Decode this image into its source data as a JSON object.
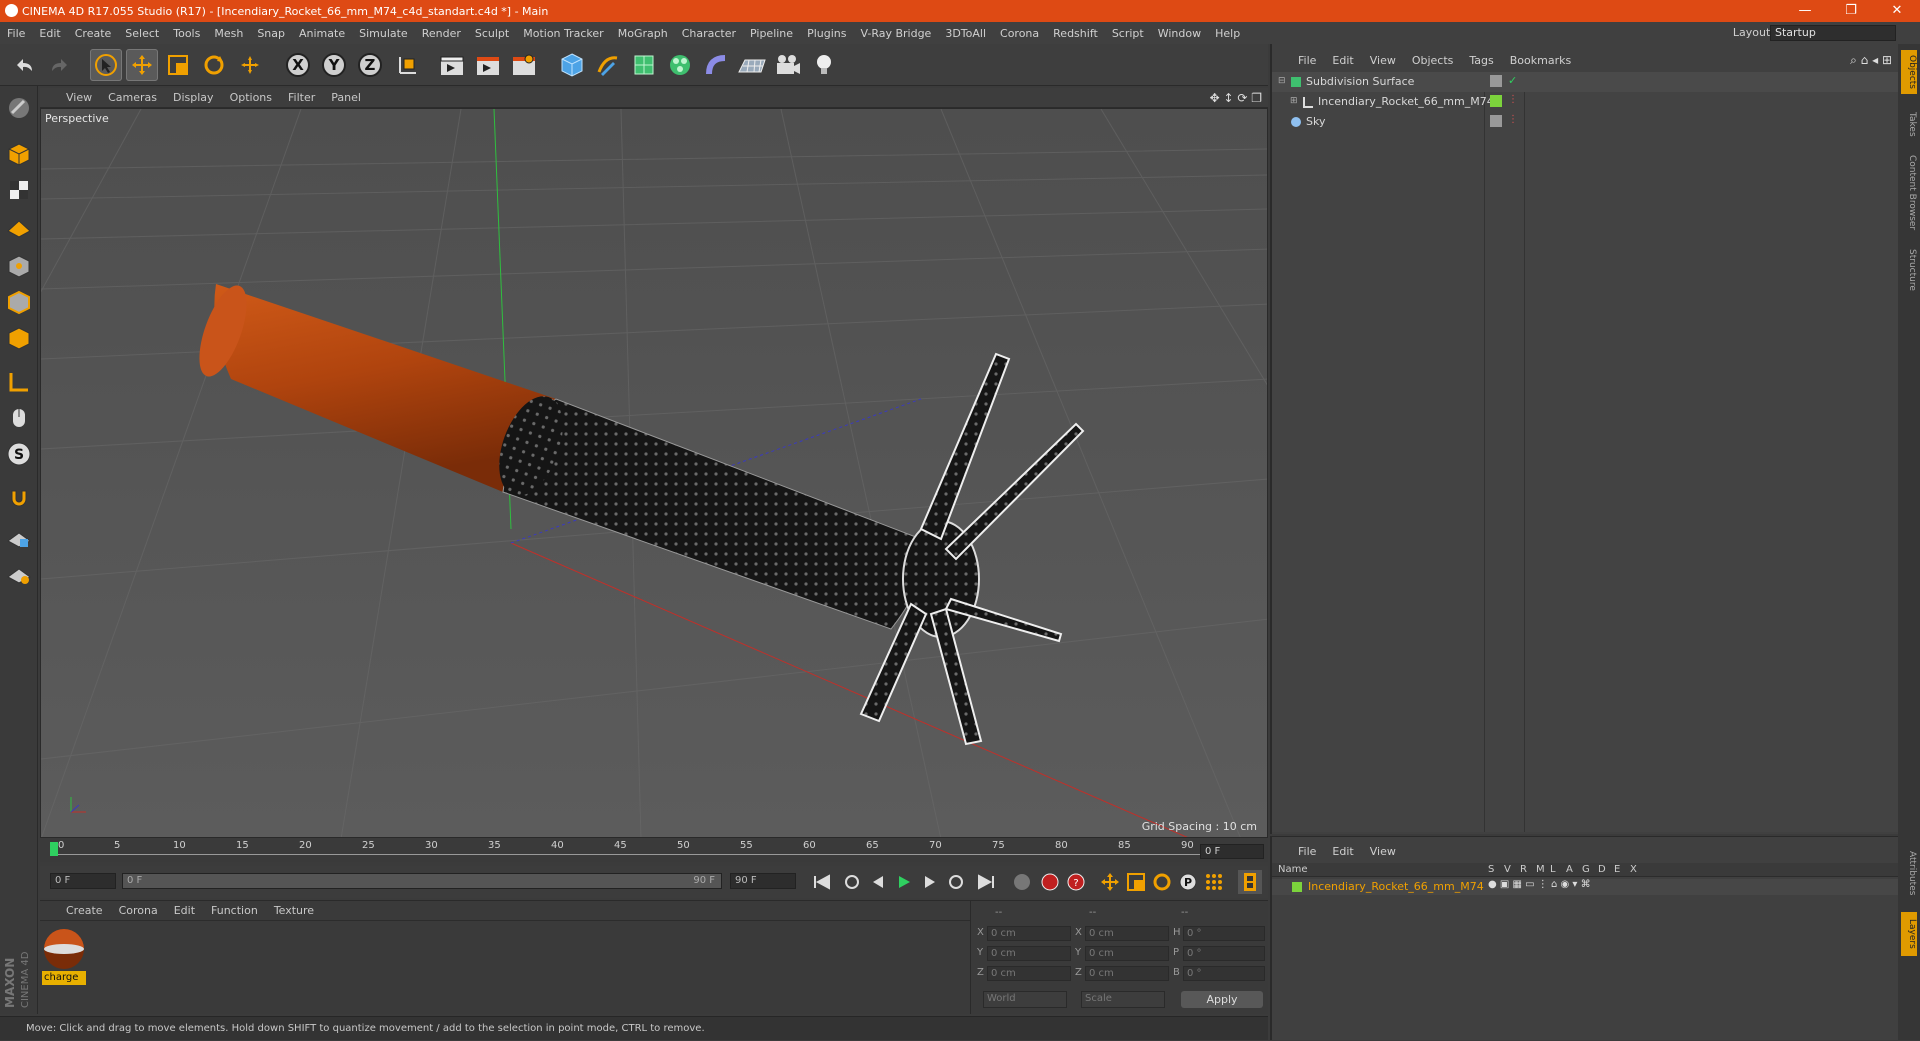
{
  "window": {
    "title": "CINEMA 4D R17.055 Studio (R17) - [Incendiary_Rocket_66_mm_M74_c4d_standart.c4d *] - Main",
    "minimize": "—",
    "restore": "❐",
    "close": "✕"
  },
  "menubar": {
    "items": [
      "File",
      "Edit",
      "Create",
      "Select",
      "Tools",
      "Mesh",
      "Snap",
      "Animate",
      "Simulate",
      "Render",
      "Sculpt",
      "Motion Tracker",
      "MoGraph",
      "Character",
      "Pipeline",
      "Plugins",
      "V-Ray Bridge",
      "3DToAll",
      "Corona",
      "Redshift",
      "Script",
      "Window",
      "Help"
    ],
    "layout_label": "Layout:",
    "layout_value": "Startup"
  },
  "toolbar": {
    "axis_x": "X",
    "axis_y": "Y",
    "axis_z": "Z"
  },
  "viewport": {
    "menu": [
      "View",
      "Cameras",
      "Display",
      "Options",
      "Filter",
      "Panel"
    ],
    "label": "Perspective",
    "grid_spacing": "Grid Spacing : 10 cm"
  },
  "timeline": {
    "ticks": [
      "0",
      "5",
      "10",
      "15",
      "20",
      "25",
      "30",
      "35",
      "40",
      "45",
      "50",
      "55",
      "60",
      "65",
      "70",
      "75",
      "80",
      "85",
      "90"
    ],
    "current_frame": "0 F"
  },
  "transport": {
    "start": "0 F",
    "range_start": "0 F",
    "range_end": "90 F",
    "end": "90 F"
  },
  "materials": {
    "menu": [
      "Create",
      "Corona",
      "Edit",
      "Function",
      "Texture"
    ],
    "items": [
      {
        "name": "charge"
      }
    ]
  },
  "coordinates": {
    "header": [
      "--",
      "--",
      "--"
    ],
    "rows": [
      {
        "a": "X",
        "av": "0 cm",
        "b": "X",
        "bv": "0 cm",
        "c": "H",
        "cv": "0 °"
      },
      {
        "a": "Y",
        "av": "0 cm",
        "b": "Y",
        "bv": "0 cm",
        "c": "P",
        "cv": "0 °"
      },
      {
        "a": "Z",
        "av": "0 cm",
        "b": "Z",
        "bv": "0 cm",
        "c": "B",
        "cv": "0 °"
      }
    ],
    "mode1": "World",
    "mode2": "Scale",
    "apply": "Apply"
  },
  "status": {
    "text": "Move: Click and drag to move elements. Hold down SHIFT to quantize movement / add to the selection in point mode, CTRL to remove."
  },
  "branding": {
    "maxon": "MAXON",
    "c4d": "CINEMA 4D"
  },
  "objects": {
    "menu": [
      "File",
      "Edit",
      "View",
      "Objects",
      "Tags",
      "Bookmarks"
    ],
    "rows": [
      {
        "name": "Subdivision Surface"
      },
      {
        "name": "Incendiary_Rocket_66_mm_M74"
      },
      {
        "name": "Sky"
      }
    ]
  },
  "layers": {
    "menu": [
      "File",
      "Edit",
      "View"
    ],
    "columns": [
      "Name",
      "S",
      "V",
      "R",
      "M",
      "L",
      "A",
      "G",
      "D",
      "E",
      "X"
    ],
    "row": {
      "name": "Incendiary_Rocket_66_mm_M74"
    }
  },
  "side_tabs": [
    "Objects",
    "Takes",
    "Content Browser",
    "Structure",
    "Attributes",
    "Layers"
  ],
  "colors": {
    "titlebar": "#de4a14",
    "accent_orange": "#f0a000",
    "rocket_body": "#c04a10",
    "layer_green": "#7cd33c"
  }
}
